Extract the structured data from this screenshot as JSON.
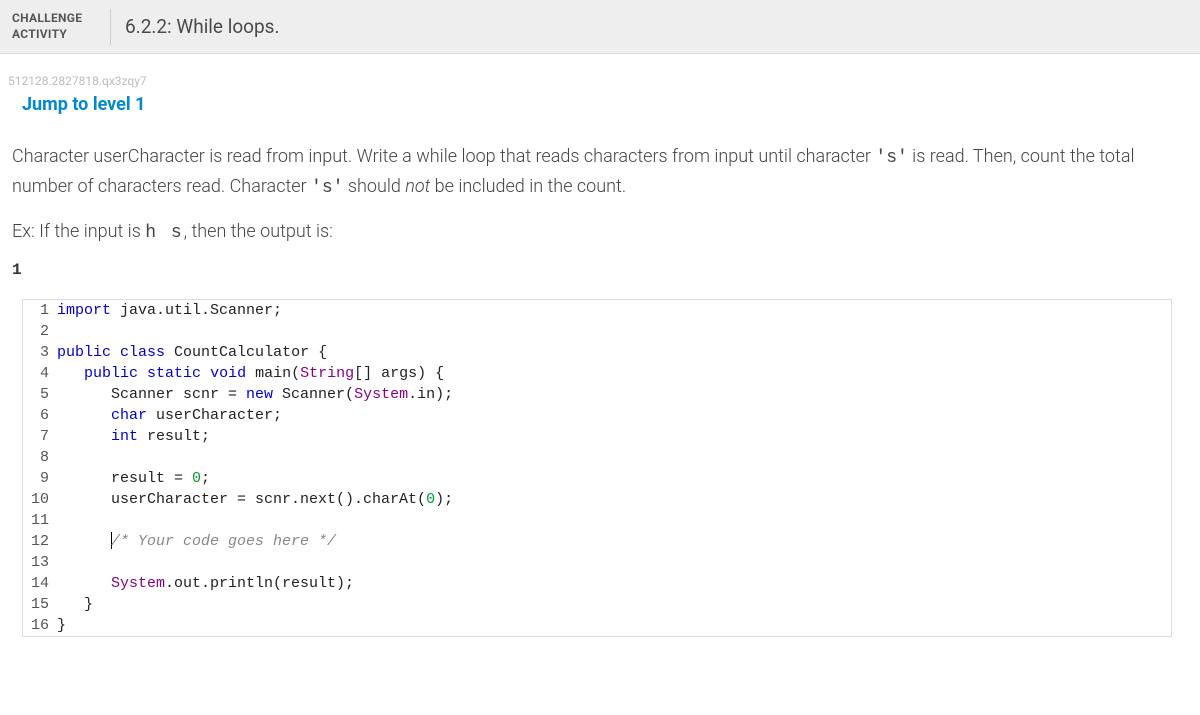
{
  "header": {
    "challenge_label_line1": "CHALLENGE",
    "challenge_label_line2": "ACTIVITY",
    "title": "6.2.2: While loops."
  },
  "seed": "512128.2827818.qx3zqy7",
  "jump_link": "Jump to level 1",
  "instructions": {
    "prefix": "Character userCharacter is read from input. Write a while loop that reads characters from input until character ",
    "sentinel1": "'s'",
    "middle": " is read. Then, count the total number of characters read. Character ",
    "sentinel2": "'s'",
    "should": " should ",
    "not": "not",
    "suffix": " be included in the count."
  },
  "example": {
    "prefix": "Ex: If the input is ",
    "input": "h s",
    "suffix": ", then the output is:"
  },
  "output_sample": "1",
  "code": {
    "lines": [
      {
        "n": "1",
        "tokens": [
          {
            "t": "import",
            "c": "kw"
          },
          {
            "t": " java.util.Scanner;",
            "c": ""
          }
        ]
      },
      {
        "n": "2",
        "tokens": []
      },
      {
        "n": "3",
        "tokens": [
          {
            "t": "public",
            "c": "kw"
          },
          {
            "t": " ",
            "c": ""
          },
          {
            "t": "class",
            "c": "kw"
          },
          {
            "t": " CountCalculator {",
            "c": ""
          }
        ]
      },
      {
        "n": "4",
        "tokens": [
          {
            "t": "   ",
            "c": ""
          },
          {
            "t": "public",
            "c": "kw"
          },
          {
            "t": " ",
            "c": ""
          },
          {
            "t": "static",
            "c": "kw"
          },
          {
            "t": " ",
            "c": ""
          },
          {
            "t": "void",
            "c": "kw"
          },
          {
            "t": " main(",
            "c": ""
          },
          {
            "t": "String",
            "c": "cls"
          },
          {
            "t": "[] args) {",
            "c": ""
          }
        ]
      },
      {
        "n": "5",
        "tokens": [
          {
            "t": "      Scanner scnr = ",
            "c": ""
          },
          {
            "t": "new",
            "c": "kw"
          },
          {
            "t": " Scanner(",
            "c": ""
          },
          {
            "t": "System",
            "c": "cls"
          },
          {
            "t": ".in);",
            "c": ""
          }
        ]
      },
      {
        "n": "6",
        "tokens": [
          {
            "t": "      ",
            "c": ""
          },
          {
            "t": "char",
            "c": "type"
          },
          {
            "t": " userCharacter;",
            "c": ""
          }
        ]
      },
      {
        "n": "7",
        "tokens": [
          {
            "t": "      ",
            "c": ""
          },
          {
            "t": "int",
            "c": "type"
          },
          {
            "t": " result;",
            "c": ""
          }
        ]
      },
      {
        "n": "8",
        "tokens": []
      },
      {
        "n": "9",
        "tokens": [
          {
            "t": "      result = ",
            "c": ""
          },
          {
            "t": "0",
            "c": "num"
          },
          {
            "t": ";",
            "c": ""
          }
        ]
      },
      {
        "n": "10",
        "tokens": [
          {
            "t": "      userCharacter = scnr.next().charAt(",
            "c": ""
          },
          {
            "t": "0",
            "c": "num"
          },
          {
            "t": ");",
            "c": ""
          }
        ]
      },
      {
        "n": "11",
        "tokens": []
      },
      {
        "n": "12",
        "tokens": [
          {
            "t": "      ",
            "c": ""
          },
          {
            "t": "CURSOR",
            "c": "cursor"
          },
          {
            "t": "/* Your code goes here */",
            "c": "comment"
          }
        ]
      },
      {
        "n": "13",
        "tokens": []
      },
      {
        "n": "14",
        "tokens": [
          {
            "t": "      ",
            "c": ""
          },
          {
            "t": "System",
            "c": "cls"
          },
          {
            "t": ".out.println(result);",
            "c": ""
          }
        ]
      },
      {
        "n": "15",
        "tokens": [
          {
            "t": "   }",
            "c": ""
          }
        ]
      },
      {
        "n": "16",
        "tokens": [
          {
            "t": "}",
            "c": ""
          }
        ]
      }
    ]
  }
}
